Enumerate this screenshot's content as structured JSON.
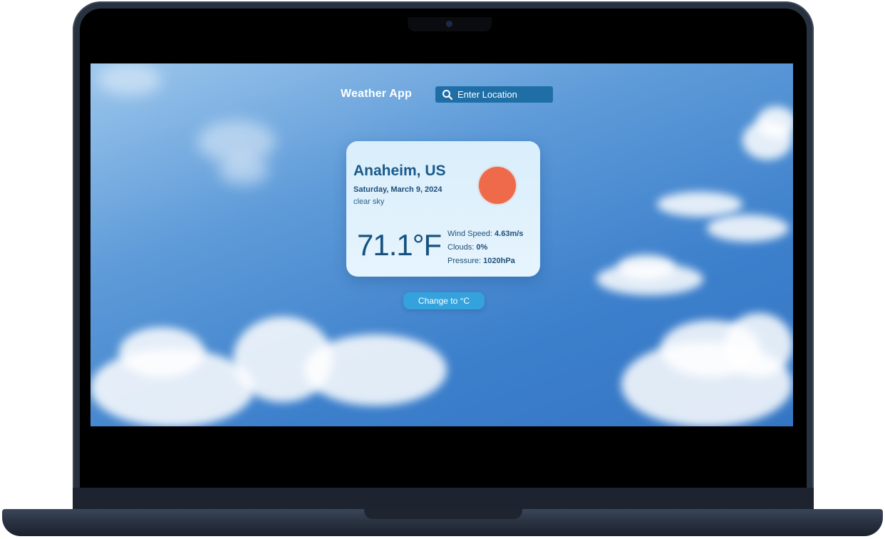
{
  "header": {
    "app_title": "Weather App",
    "search_placeholder": "Enter Location"
  },
  "weather": {
    "city": "Anaheim, US",
    "date": "Saturday, March 9, 2024",
    "description": "clear sky",
    "temperature": "71.1°F",
    "wind_label": "Wind Speed:",
    "wind_value": "4.63m/s",
    "clouds_label": "Clouds:",
    "clouds_value": "0%",
    "pressure_label": "Pressure:",
    "pressure_value": "1020hPa",
    "condition_icon": "sun-icon"
  },
  "actions": {
    "unit_toggle_label": "Change to °C"
  },
  "colors": {
    "sun": "#ef6a4a",
    "search_bg": "#1f6fa6",
    "button_bg": "#34a2dc",
    "card_text": "#1a5a8a"
  }
}
